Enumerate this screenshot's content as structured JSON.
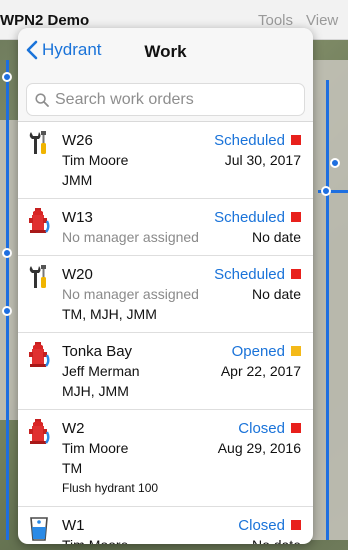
{
  "app": {
    "title": "WPN2 Demo",
    "menu": [
      "Tools",
      "View"
    ]
  },
  "nav": {
    "back_label": "Hydrant",
    "title": "Work"
  },
  "search": {
    "placeholder": "Search work orders",
    "value": ""
  },
  "colors": {
    "accent": "#1a73d9",
    "status_red": "#e8201c",
    "status_yellow": "#f4b918"
  },
  "work_orders": [
    {
      "id": "W26",
      "icon": "wrench-screwdriver-icon",
      "status": "Scheduled",
      "status_color": "#e8201c",
      "person": "Tim Moore",
      "person_muted": false,
      "date": "Jul 30, 2017",
      "crew": "JMM",
      "note": ""
    },
    {
      "id": "W13",
      "icon": "hydrant-icon",
      "status": "Scheduled",
      "status_color": "#e8201c",
      "person": "No manager assigned",
      "person_muted": true,
      "date": "No date",
      "crew": "",
      "note": ""
    },
    {
      "id": "W20",
      "icon": "wrench-screwdriver-icon",
      "status": "Scheduled",
      "status_color": "#e8201c",
      "person": "No manager assigned",
      "person_muted": true,
      "date": "No date",
      "crew": "TM, MJH, JMM",
      "note": ""
    },
    {
      "id": "Tonka Bay",
      "icon": "hydrant-icon",
      "status": "Opened",
      "status_color": "#f4b918",
      "person": "Jeff Merman",
      "person_muted": false,
      "date": "Apr 22, 2017",
      "crew": "MJH, JMM",
      "note": ""
    },
    {
      "id": "W2",
      "icon": "hydrant-icon",
      "status": "Closed",
      "status_color": "#e8201c",
      "person": "Tim Moore",
      "person_muted": false,
      "date": "Aug 29, 2016",
      "crew": "TM",
      "note": "Flush hydrant 100"
    },
    {
      "id": "W1",
      "icon": "water-glass-icon",
      "status": "Closed",
      "status_color": "#e8201c",
      "person": "Tim Moore",
      "person_muted": false,
      "date": "No date",
      "crew": "",
      "note": ""
    }
  ]
}
